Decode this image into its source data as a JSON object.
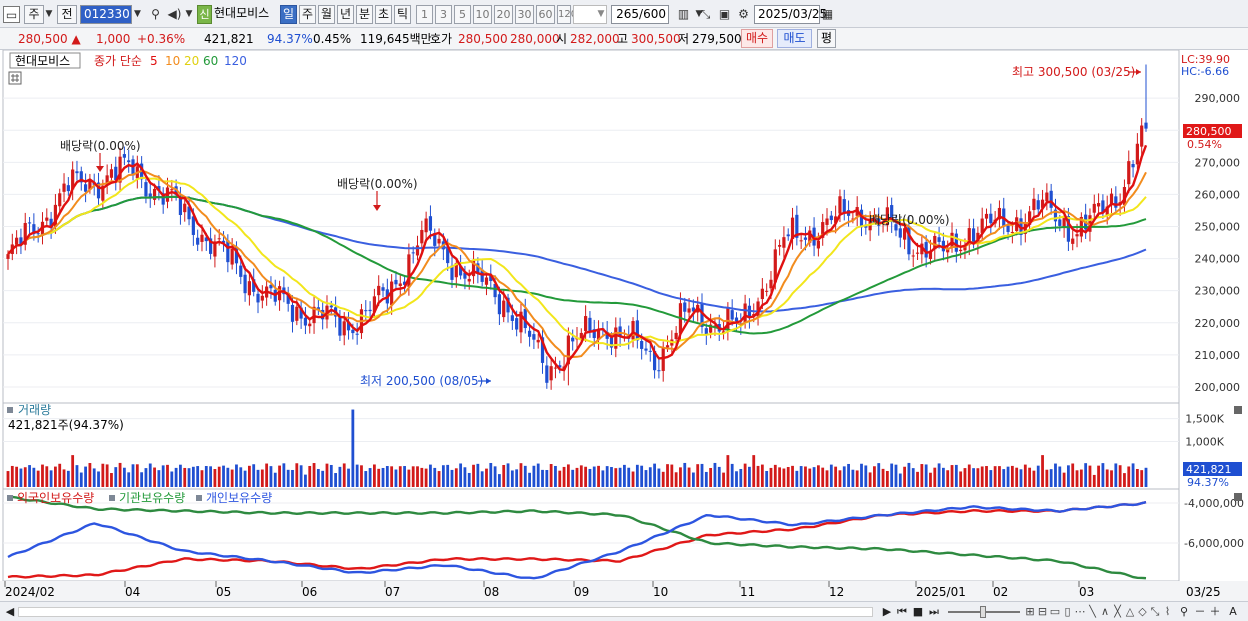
{
  "toolbar": {
    "market": "주",
    "period_sel": "전",
    "code": "012330",
    "stock_badge": "신",
    "stock_name": "현대모비스",
    "periods": [
      "일",
      "주",
      "월",
      "년",
      "분",
      "초",
      "틱"
    ],
    "active_period": "일",
    "minute_steps": [
      "1",
      "3",
      "5",
      "10",
      "20",
      "30",
      "60",
      "120"
    ],
    "count": "265",
    "count_max": "/600",
    "date": "2025/03/25"
  },
  "quote": {
    "price": "280,500",
    "change": "1,000",
    "change_pct": "+0.36%",
    "volume": "421,821",
    "volume_ratio": "94.37%",
    "turnover": "0.45%",
    "amount": "119,645백만",
    "ask_label": "호가",
    "ask": "280,500",
    "bid": "280,000",
    "open_label": "시",
    "open": "282,000",
    "high_label": "고",
    "high": "300,500",
    "low_label": "저",
    "low": "279,500",
    "buy_button": "매수",
    "sell_button": "매도",
    "eval_button": "평"
  },
  "price_panel": {
    "stock_label": "현대모비스",
    "legend_title": "종가 단순",
    "ma_periods": [
      "5",
      "10",
      "20",
      "60",
      "120"
    ],
    "lc_label": "LC:39.90",
    "hc_label": "HC:-6.66",
    "current_price_label": "280,500",
    "current_pct_label": "0.54%",
    "high_annotation": "최고 300,500 (03/25)",
    "low_annotation": "최저 200,500 (08/05)",
    "dividend_labels": [
      "배당락(0.00%)",
      "배당락(0.00%)",
      "배당락(0.00%)"
    ]
  },
  "volume_panel": {
    "title": "거래량",
    "readout": "421,821주(94.37%)",
    "current_label": "421,821",
    "current_pct": "94.37%"
  },
  "holding_panel": {
    "legend": [
      "외국인보유수량",
      "기관보유수량",
      "개인보유수량"
    ]
  },
  "colors": {
    "up": "#d21a1a",
    "down": "#1f4fd1",
    "ma5": "#e01010",
    "ma10": "#f28c1e",
    "ma20": "#f2e61c",
    "ma60": "#239a3a",
    "ma120": "#3a5fe0",
    "foreign": "#e01818",
    "institution": "#2e8a40",
    "individual": "#2d55e0"
  },
  "chart_data": [
    {
      "type": "candlestick",
      "title": "",
      "x_labels": [
        "2024/02",
        "04",
        "05",
        "06",
        "07",
        "08",
        "09",
        "10",
        "11",
        "12",
        "2025/01",
        "02",
        "03"
      ],
      "last_date_label": "03/25",
      "y_ticks": [
        "290,000",
        "280,000",
        "270,000",
        "260,000",
        "250,000",
        "240,000",
        "230,000",
        "220,000",
        "210,000",
        "200,000"
      ],
      "ylim": [
        195000,
        305000
      ],
      "close_anchors": [
        [
          "2024/02",
          240000
        ],
        [
          "03-mid",
          262000
        ],
        [
          "03-end",
          268000
        ],
        [
          "04-mid",
          255000
        ],
        [
          "05-start",
          241000
        ],
        [
          "05-mid",
          228000
        ],
        [
          "06-mid",
          219000
        ],
        [
          "06-end",
          228000
        ],
        [
          "07-start",
          248000
        ],
        [
          "07-mid",
          236000
        ],
        [
          "07-end",
          226000
        ],
        [
          "08-05",
          205000
        ],
        [
          "08-mid",
          213000
        ],
        [
          "09-start",
          219000
        ],
        [
          "09-mid",
          209000
        ],
        [
          "09-end",
          223000
        ],
        [
          "10-mid",
          218000
        ],
        [
          "10-end",
          245000
        ],
        [
          "11-start",
          251000
        ],
        [
          "11-mid",
          255000
        ],
        [
          "12-start",
          247000
        ],
        [
          "12-mid",
          241000
        ],
        [
          "2025/01",
          249000
        ],
        [
          "01-mid",
          251000
        ],
        [
          "02-start",
          256000
        ],
        [
          "02-mid",
          249000
        ],
        [
          "03-start",
          252000
        ],
        [
          "03-mid",
          262000
        ],
        [
          "03/25",
          280500
        ]
      ],
      "high": 300500,
      "low": 200500,
      "moving_averages": [
        "5",
        "10",
        "20",
        "60",
        "120"
      ]
    },
    {
      "type": "bar",
      "title": "거래량",
      "y_ticks": [
        "1,500K",
        "1,000K"
      ],
      "ylim": [
        0,
        1800000
      ],
      "last_value": 421821,
      "peak_value": 1700000
    },
    {
      "type": "line",
      "title": "",
      "y_ticks": [
        "-4,000,000",
        "-6,000,000"
      ],
      "series": [
        {
          "name": "외국인보유수량",
          "trend": "low-flat-then-rising"
        },
        {
          "name": "기관보유수량",
          "trend": "high-then-falling"
        },
        {
          "name": "개인보유수량",
          "trend": "fluctuating-rising"
        }
      ]
    }
  ],
  "bottombar": {
    "scroll_left": "◀",
    "icons": [
      "▶",
      "⏮",
      "■",
      "⏭"
    ],
    "zoom": [
      "－",
      "＋",
      "A"
    ]
  }
}
